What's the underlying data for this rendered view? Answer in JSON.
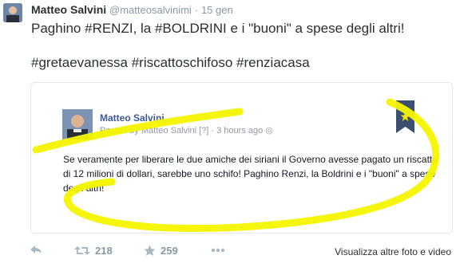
{
  "tweet": {
    "author_name": "Matteo Salvini",
    "author_handle": "@matteosalvinimi",
    "separator": "·",
    "date": "15 gen",
    "text_line1": "Paghino #RENZI, la #BOLDRINI e i \"buoni\" a spese degli altri!",
    "text_line2": "#gretaevanessa #riscattoschifoso #renziacasa"
  },
  "embed": {
    "author_name": "Matteo Salvini",
    "meta": "Posted by Matteo Salvini [?] · 3 hours ago ◎",
    "text": "Se veramente per liberare le due amiche dei siriani il Governo avesse pagato un riscatto di 12 milioni di dollari, sarebbe uno schifo! Paghino Renzi, la Boldrini e i \"buoni\" a spese degli altri!"
  },
  "actions": {
    "retweet_count": "218",
    "favorite_count": "259",
    "more_media_label": "Visualizza altre foto e video"
  },
  "colors": {
    "scribble": "#f5f500",
    "ribbon": "#3b5070",
    "ribbon_star": "#f2e600"
  }
}
